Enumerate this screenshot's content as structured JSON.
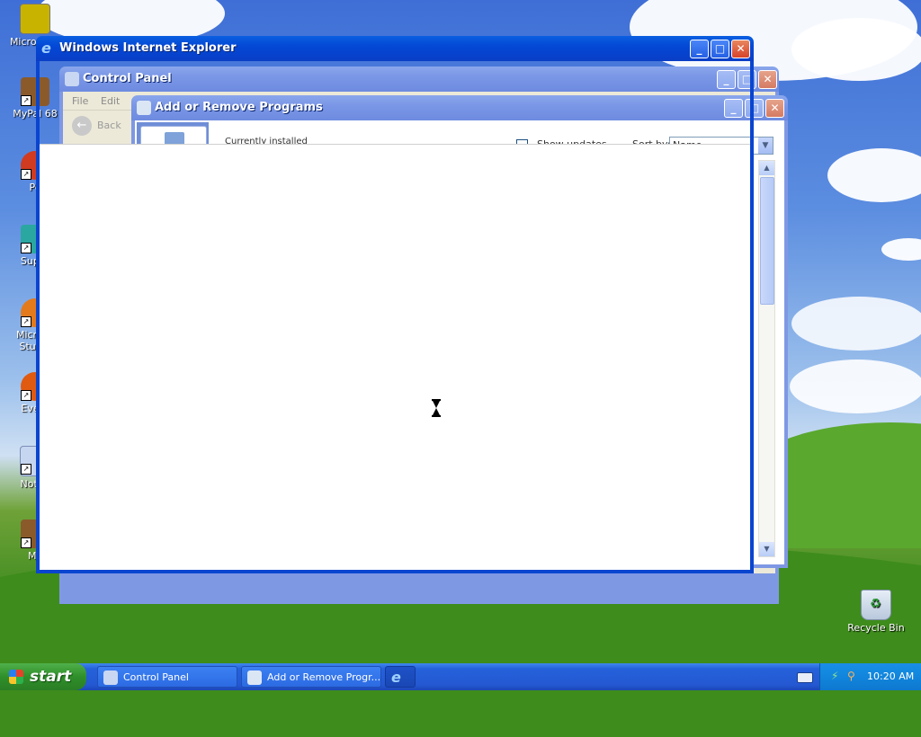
{
  "desktop_icons": [
    {
      "label": "Micro Outl",
      "color": "#c8b300"
    },
    {
      "label": "MyPal 68",
      "color": "#8a5a2b"
    },
    {
      "label": "Pe",
      "color": "#d13b1f"
    },
    {
      "label": "Super",
      "color": "#2aa7a0"
    },
    {
      "label": "Microso Studio",
      "color": "#e37a1c"
    },
    {
      "label": "Every",
      "color": "#e05a10"
    },
    {
      "label": "Notep",
      "color": "#c7d6f0"
    },
    {
      "label": "My",
      "color": "#8a5a2b"
    }
  ],
  "recycle_bin": {
    "label": "Recycle Bin"
  },
  "ie_window": {
    "title": "Windows Internet Explorer"
  },
  "control_panel": {
    "title": "Control Panel",
    "menu_file": "File",
    "menu_edit": "Edit",
    "back_label": "Back"
  },
  "arp_window": {
    "title": "Add or Remove Programs",
    "partial_text": "Currently installed",
    "show_updates_label": "Show updates",
    "sort_by_label": "Sort by:",
    "sort_by_value": "Name"
  },
  "taskbar": {
    "start_label": "start",
    "tasks": [
      {
        "label": "Control Panel"
      },
      {
        "label": "Add or Remove Progr..."
      }
    ],
    "clock": "10:20 AM"
  },
  "colors": {
    "title_active": "#0348d6",
    "title_inactive": "#7a96e6",
    "close_red": "#d8442a"
  }
}
